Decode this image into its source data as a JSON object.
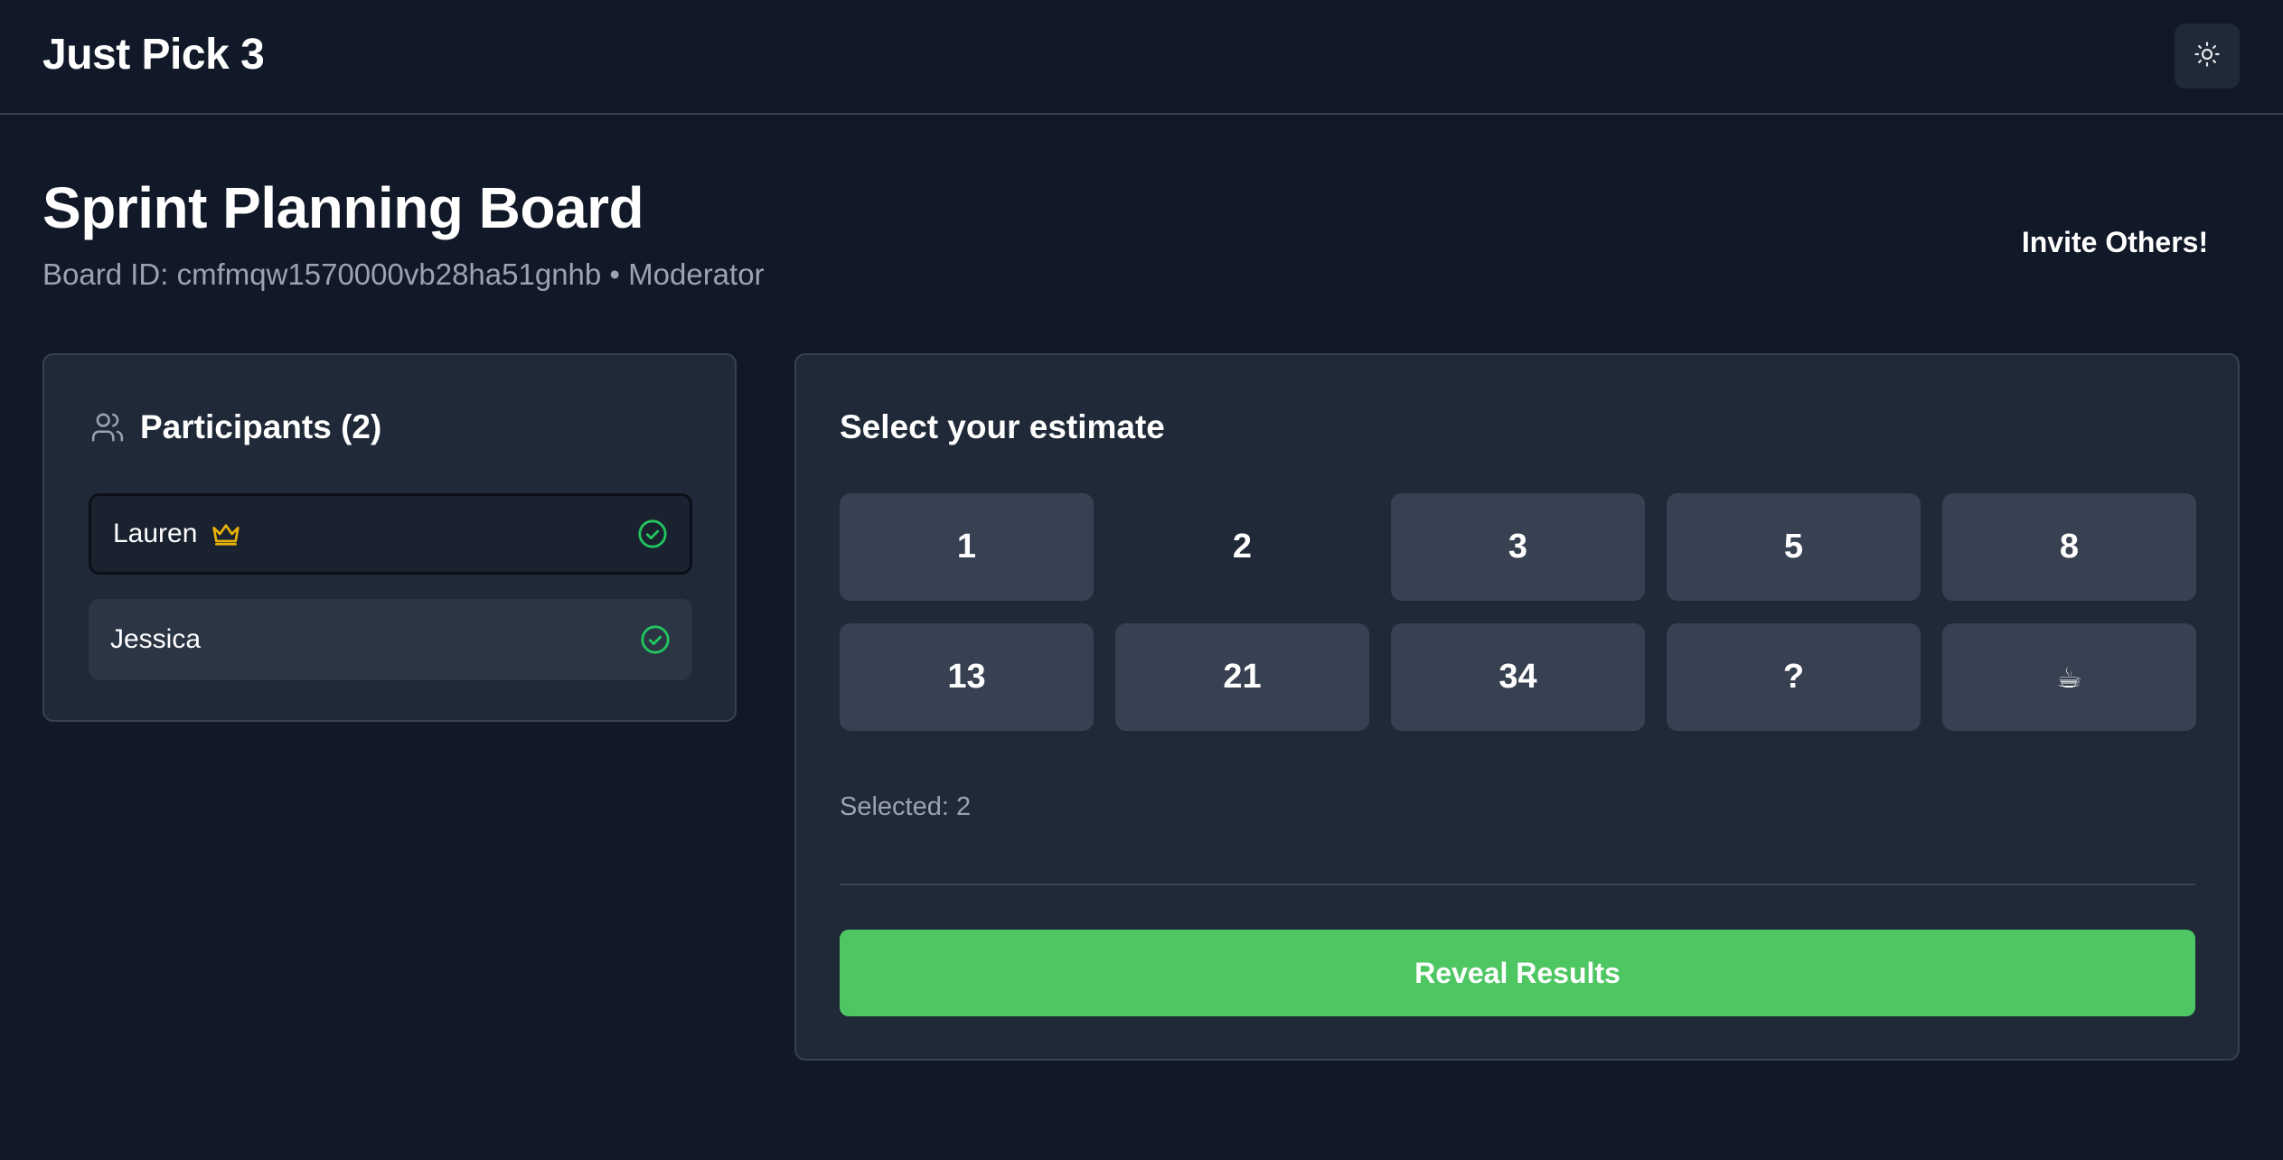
{
  "header": {
    "app_title": "Just Pick 3",
    "theme_toggle_icon": "sun-icon"
  },
  "board": {
    "title": "Sprint Planning Board",
    "meta": "Board ID: cmfmqw1570000vb28ha51gnhb • Moderator",
    "invite_label": "Invite Others!"
  },
  "participants": {
    "heading": "Participants (2)",
    "heading_icon": "users-icon",
    "items": [
      {
        "name": "Lauren",
        "is_moderator": true,
        "has_voted": true
      },
      {
        "name": "Jessica",
        "is_moderator": false,
        "has_voted": true
      }
    ]
  },
  "estimate": {
    "heading": "Select your estimate",
    "cards": [
      "1",
      "2",
      "3",
      "5",
      "8",
      "13",
      "21",
      "34",
      "?",
      "☕"
    ],
    "selected_value": "2",
    "selected_text": "Selected: 2",
    "reveal_label": "Reveal Results"
  },
  "colors": {
    "background": "#111827",
    "card": "#1f2937",
    "border": "#374151",
    "accent_green": "#4ec662",
    "check_green": "#22c55e",
    "crown_gold": "#eab308",
    "muted_text": "#9ca3af"
  }
}
